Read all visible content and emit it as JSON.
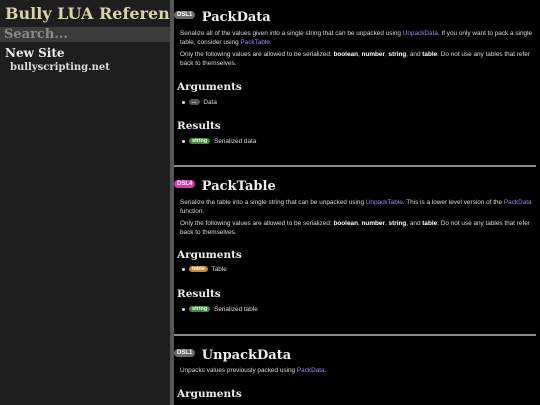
{
  "sidebar": {
    "title": "Bully LUA Reference",
    "search_placeholder": "Search...",
    "nav_heading": "New Site",
    "nav_link": "bullyscripting.net"
  },
  "colors": {
    "link": "#9a8cf0",
    "badge_grey": "#6a6a6a",
    "badge_pink": "#d63aa8",
    "type_string": "#3d8b3d",
    "type_table": "#c8842c"
  },
  "functions": [
    {
      "badge": "DSL1",
      "name": "PackData",
      "desc1_a": "Serialize all of the values given into a single string that can be unpacked using ",
      "desc1_link1": "UnpackData",
      "desc1_b": ". If you only want to pack a single table, consider using ",
      "desc1_link2": "PackTable",
      "desc1_c": ".",
      "desc2_a": "Only the following values are allowed to be serialized: ",
      "v1": "boolean",
      "sep1": ", ",
      "v2": "number",
      "sep2": ", ",
      "v3": "string",
      "sep3": ", and ",
      "v4": "table",
      "desc2_b": ". Do not use any tables that refer back to themselves.",
      "arguments_heading": "Arguments",
      "arg_type": "...",
      "arg_label": "Data",
      "results_heading": "Results",
      "result_type": "string",
      "result_label": "Serialized data"
    },
    {
      "badge": "DSL4",
      "name": "PackTable",
      "desc1_a": "Serialize the table into a single string that can be unpacked using ",
      "desc1_link1": "UnpackTable",
      "desc1_b": ". This is a lower level version of the ",
      "desc1_link2": "PackData",
      "desc1_c": " function.",
      "desc2_a": "Only the following values are allowed to be serialized: ",
      "v1": "boolean",
      "sep1": ", ",
      "v2": "number",
      "sep2": ", ",
      "v3": "string",
      "sep3": ", and ",
      "v4": "table",
      "desc2_b": ". Do not use any tables that refer back to themselves.",
      "arguments_heading": "Arguments",
      "arg_type": "table",
      "arg_label": "Table",
      "results_heading": "Results",
      "result_type": "string",
      "result_label": "Serialized table"
    },
    {
      "badge": "DSL1",
      "name": "UnpackData",
      "desc1_a": "Unpacks values previously packed using ",
      "desc1_link1": "PackData",
      "desc1_c": ".",
      "arguments_heading": "Arguments"
    }
  ]
}
